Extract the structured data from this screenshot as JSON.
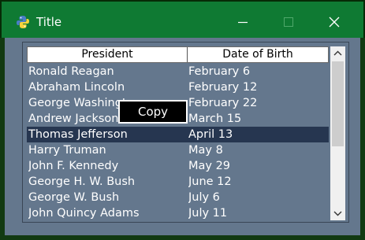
{
  "window": {
    "title": "Title"
  },
  "table": {
    "headers": [
      "President",
      "Date of Birth"
    ],
    "rows": [
      [
        "Ronald Reagan",
        "February 6"
      ],
      [
        "Abraham Lincoln",
        "February 12"
      ],
      [
        "George Washington",
        "February 22"
      ],
      [
        "Andrew Jackson",
        "March 15"
      ],
      [
        "Thomas Jefferson",
        "April 13"
      ],
      [
        "Harry Truman",
        "May 8"
      ],
      [
        "John F. Kennedy",
        "May 29"
      ],
      [
        "George H. W. Bush",
        "June 12"
      ],
      [
        "George W. Bush",
        "July 6"
      ],
      [
        "John Quincy Adams",
        "July 11"
      ]
    ],
    "selected_index": 4
  },
  "context_menu": {
    "copy_label": "Copy"
  },
  "colors": {
    "titlebar": "#0f7a33",
    "table_bg": "#64778d",
    "selected_row": "#263650"
  }
}
